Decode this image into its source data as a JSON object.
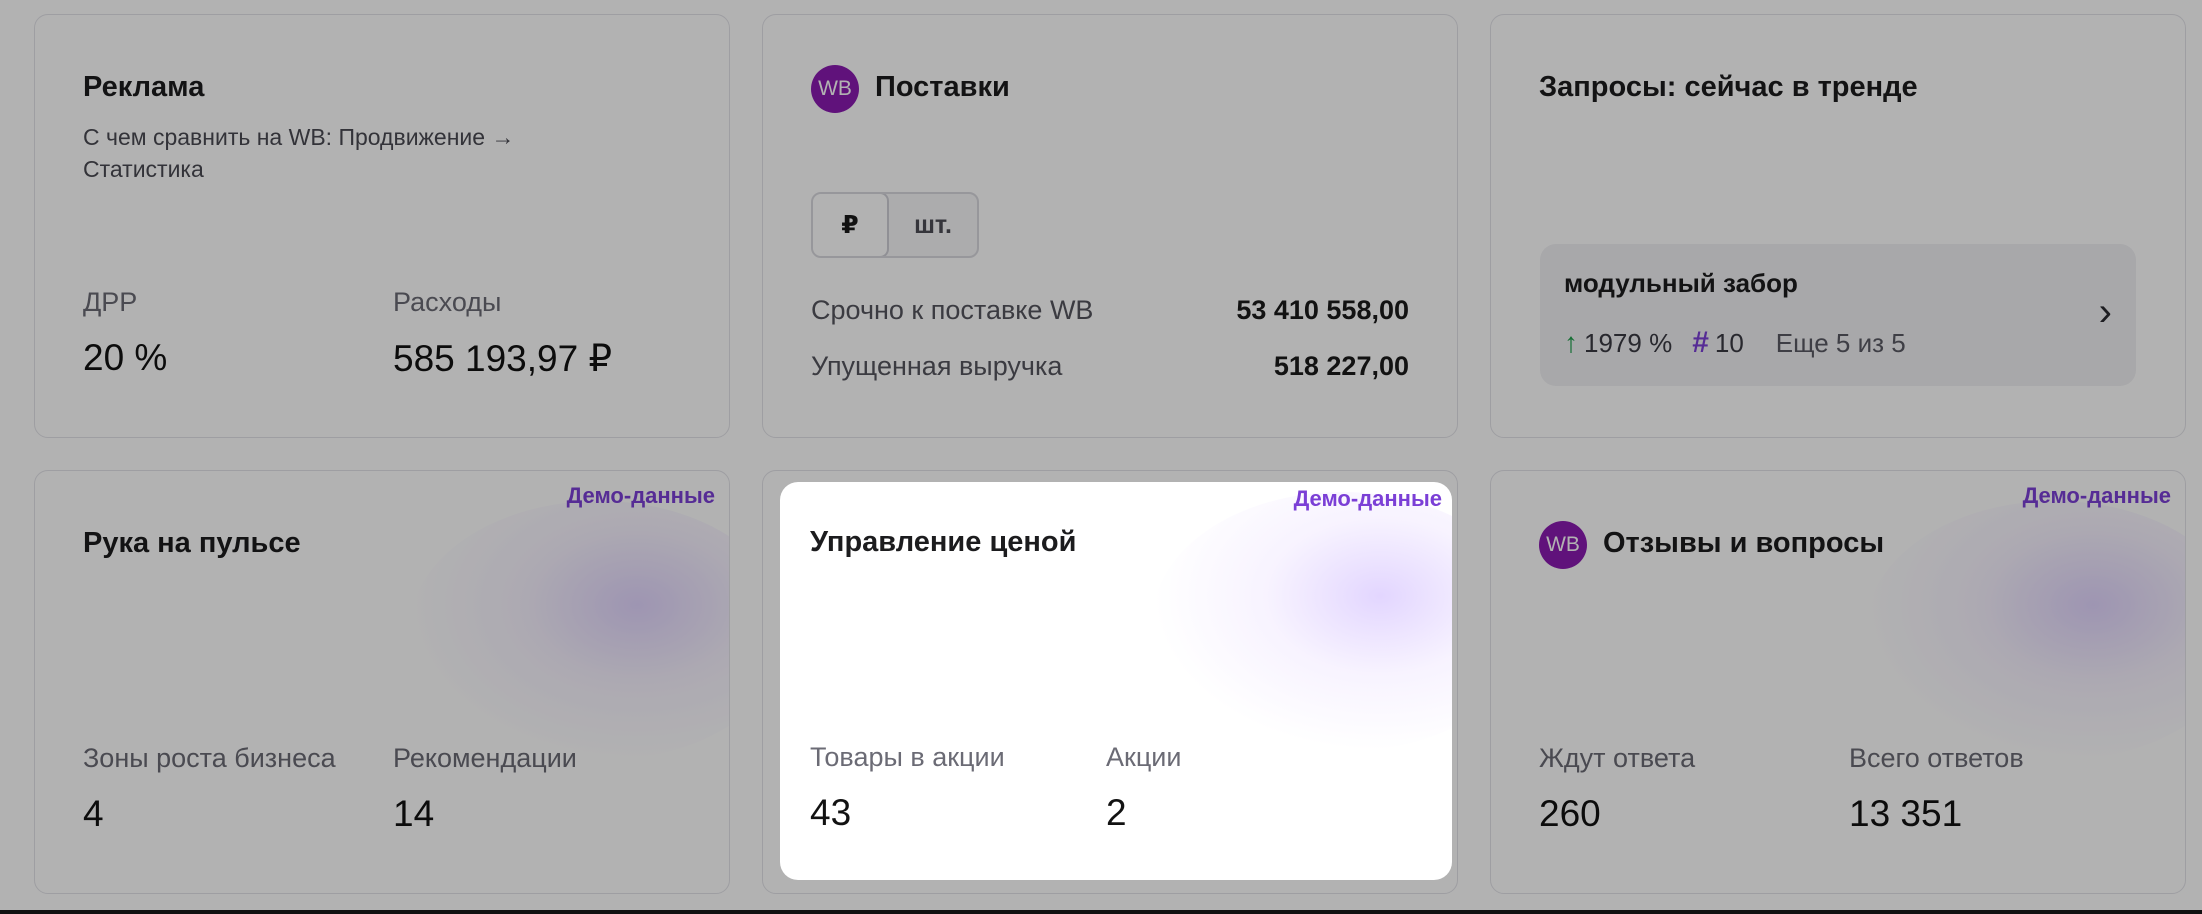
{
  "cards": {
    "ads": {
      "title": "Реклама",
      "subtitle": "С чем сравнить на WB: Продвижение → Статистика",
      "metrics": [
        {
          "label": "ДРР",
          "value": "20 %"
        },
        {
          "label": "Расходы",
          "value": "585 193,97 ₽"
        }
      ]
    },
    "supplies": {
      "logo": "WB",
      "title": "Поставки",
      "toggle": {
        "ruble": "₽",
        "pieces": "шт.",
        "active": "₽"
      },
      "rows": [
        {
          "label": "Срочно к поставке WB",
          "value": "53 410 558,00"
        },
        {
          "label": "Упущенная выручка",
          "value": "518 227,00"
        }
      ]
    },
    "trends": {
      "title": "Запросы: сейчас в тренде",
      "item": {
        "query": "модульный забор",
        "growth": "1979 %",
        "rank": "10",
        "more": "Еще 5 из 5"
      },
      "colors": {
        "growth_arrow": "#1f9e4a",
        "hash": "#7b3fd6"
      }
    },
    "pulse": {
      "badge": "Демо-данные",
      "title": "Рука на пульсе",
      "metrics": [
        {
          "label": "Зоны роста бизнеса",
          "value": "4"
        },
        {
          "label": "Рекомендации",
          "value": "14"
        }
      ]
    },
    "pricing": {
      "badge": "Демо-данные",
      "title": "Управление ценой",
      "metrics": [
        {
          "label": "Товары в акции",
          "value": "43"
        },
        {
          "label": "Акции",
          "value": "2"
        }
      ]
    },
    "reviews": {
      "badge": "Демо-данные",
      "logo": "WB",
      "title": "Отзывы и вопросы",
      "metrics": [
        {
          "label": "Ждут ответа",
          "value": "260"
        },
        {
          "label": "Всего ответов",
          "value": "13 351"
        }
      ]
    }
  },
  "icons": {
    "growth": "arrow-up-icon",
    "rank": "hash-icon",
    "open": "chevron-right-icon"
  },
  "colors": {
    "accent": "#7b3fd6",
    "wb_brand": "#8a1bb0",
    "overlay": "rgba(0,0,0,0.3)"
  }
}
